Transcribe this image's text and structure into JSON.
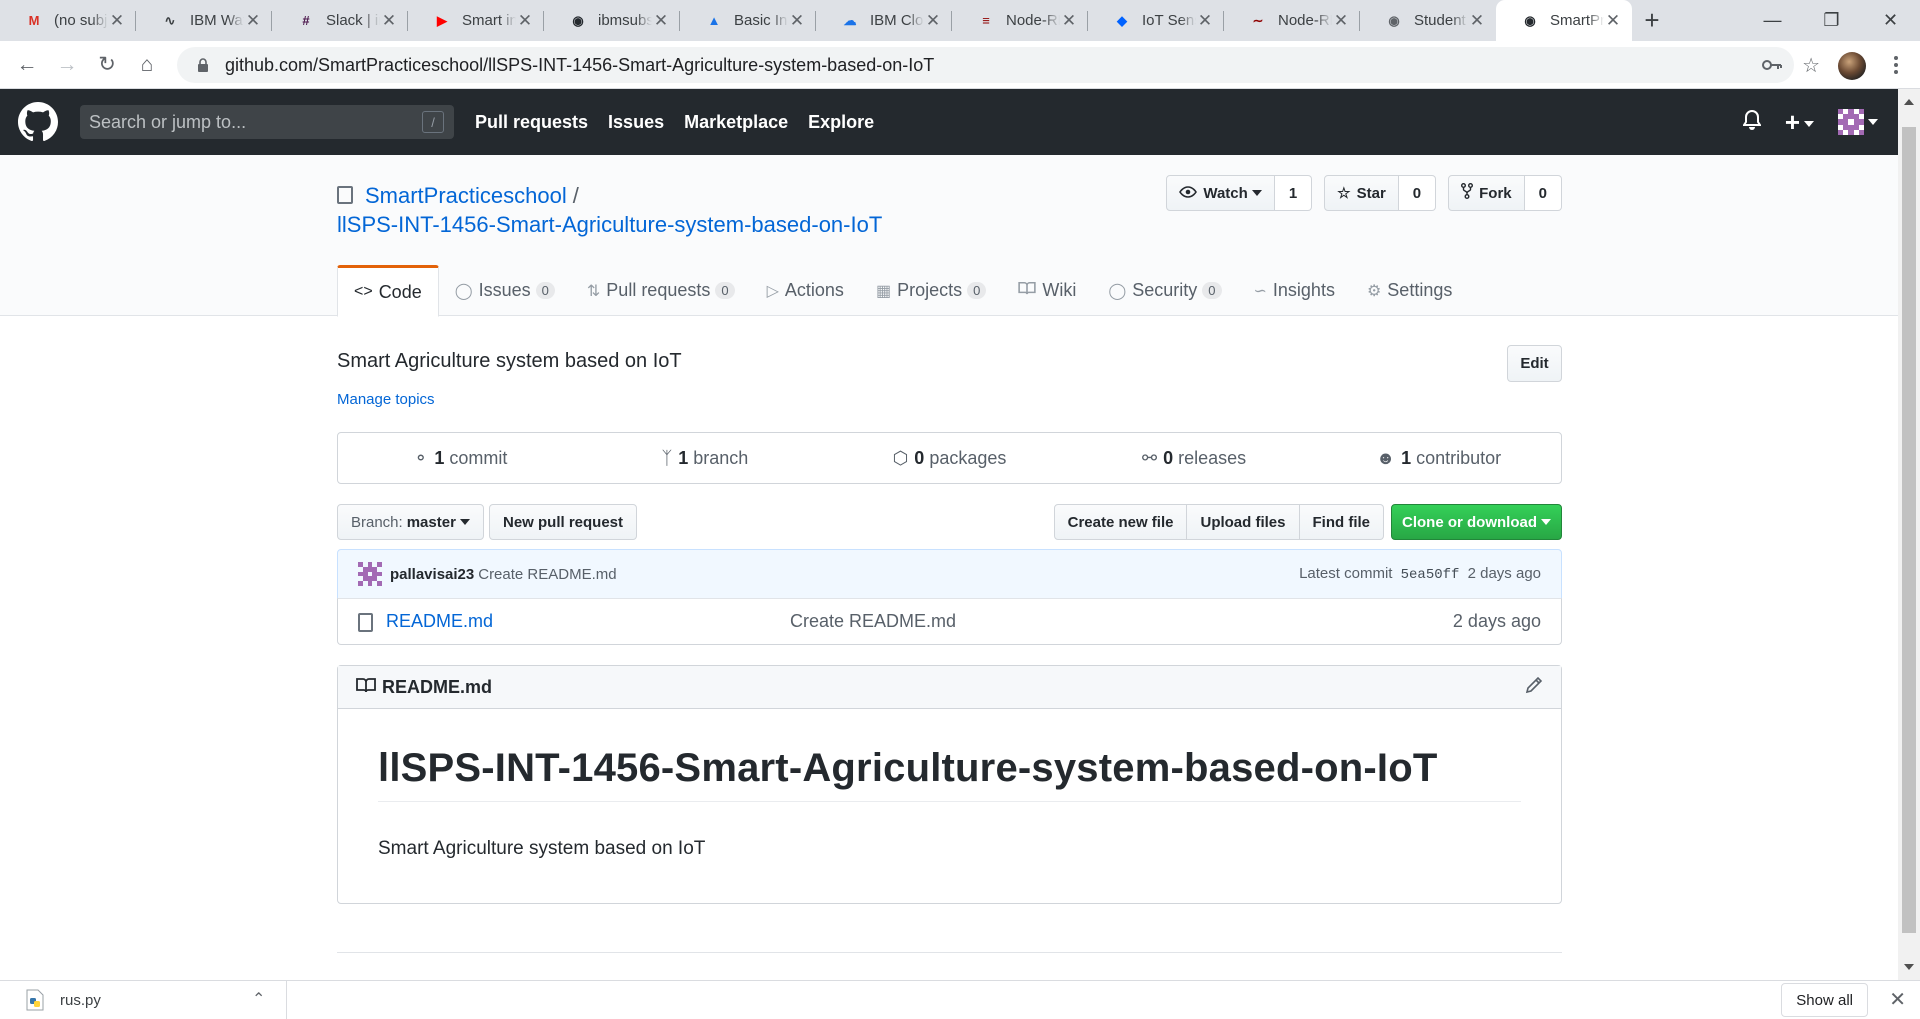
{
  "browser": {
    "tabs": [
      {
        "title": "(no subject)",
        "icon": "gmail-icon",
        "color": "#d93025",
        "active": false
      },
      {
        "title": "IBM Watson",
        "icon": "watson-icon",
        "color": "#3c4043",
        "active": false
      },
      {
        "title": "Slack | internship",
        "icon": "slack-icon",
        "color": "#4a154b",
        "active": false
      },
      {
        "title": "Smart internz",
        "icon": "youtube-icon",
        "color": "#ff0000",
        "active": false
      },
      {
        "title": "ibmsubscription",
        "icon": "github-icon",
        "color": "#24292e",
        "active": false
      },
      {
        "title": "Basic Internet",
        "icon": "drive-icon",
        "color": "#1a73e8",
        "active": false
      },
      {
        "title": "IBM Cloud",
        "icon": "cloud-icon",
        "color": "#1a73e8",
        "active": false
      },
      {
        "title": "Node-RED",
        "icon": "nodered-icon",
        "color": "#8f0000",
        "active": false
      },
      {
        "title": "IoT Sensor",
        "icon": "iot-icon",
        "color": "#0062ff",
        "active": false
      },
      {
        "title": "Node-RED",
        "icon": "nodered-flow-icon",
        "color": "#8f0000",
        "active": false
      },
      {
        "title": "Student",
        "icon": "globe-icon",
        "color": "#5f6368",
        "active": false
      },
      {
        "title": "SmartPracticeschool",
        "icon": "github-icon",
        "color": "#24292e",
        "active": true
      }
    ],
    "url": "github.com/SmartPracticeschool/llSPS-INT-1456-Smart-Agriculture-system-based-on-IoT"
  },
  "github_header": {
    "search_placeholder": "Search or jump to...",
    "slash_key": "/",
    "nav": [
      "Pull requests",
      "Issues",
      "Marketplace",
      "Explore"
    ]
  },
  "repo": {
    "owner": "SmartPracticeschool",
    "separator": "/",
    "name": "llSPS-INT-1456-Smart-Agriculture-system-based-on-IoT",
    "watch_label": "Watch",
    "watch_count": "1",
    "star_label": "Star",
    "star_count": "0",
    "fork_label": "Fork",
    "fork_count": "0",
    "tabs": [
      {
        "label": "Code",
        "icon": "code-icon",
        "count": null,
        "selected": true
      },
      {
        "label": "Issues",
        "icon": "issue-icon",
        "count": "0"
      },
      {
        "label": "Pull requests",
        "icon": "pull-request-icon",
        "count": "0"
      },
      {
        "label": "Actions",
        "icon": "play-icon",
        "count": null
      },
      {
        "label": "Projects",
        "icon": "project-icon",
        "count": "0"
      },
      {
        "label": "Wiki",
        "icon": "book-icon",
        "count": null
      },
      {
        "label": "Security",
        "icon": "shield-icon",
        "count": "0"
      },
      {
        "label": "Insights",
        "icon": "graph-icon",
        "count": null
      },
      {
        "label": "Settings",
        "icon": "gear-icon",
        "count": null
      }
    ],
    "description": "Smart Agriculture system based on IoT",
    "manage_topics": "Manage topics",
    "edit_label": "Edit",
    "summary": [
      {
        "icon": "commit-icon",
        "num": "1",
        "label": "commit"
      },
      {
        "icon": "branch-icon",
        "num": "1",
        "label": "branch"
      },
      {
        "icon": "package-icon",
        "num": "0",
        "label": "packages"
      },
      {
        "icon": "tag-icon",
        "num": "0",
        "label": "releases"
      },
      {
        "icon": "people-icon",
        "num": "1",
        "label": "contributor"
      }
    ],
    "branch_prefix": "Branch:",
    "branch_name": "master",
    "new_pr": "New pull request",
    "create_file": "Create new file",
    "upload_files": "Upload files",
    "find_file": "Find file",
    "clone_label": "Clone or download",
    "commit": {
      "user": "pallavisai23",
      "message": "Create README.md",
      "latest_label": "Latest commit",
      "sha": "5ea50ff",
      "age": "2 days ago"
    },
    "files": [
      {
        "name": "README.md",
        "message": "Create README.md",
        "age": "2 days ago"
      }
    ],
    "readme": {
      "header": "README.md",
      "h1": "llSPS-INT-1456-Smart-Agriculture-system-based-on-IoT",
      "body": "Smart Agriculture system based on IoT"
    }
  },
  "downloads": {
    "file": "rus.py",
    "show_all": "Show all"
  },
  "colors": {
    "accent": "#0366d6",
    "green": "#28a745",
    "tab_underline": "#e36209"
  }
}
